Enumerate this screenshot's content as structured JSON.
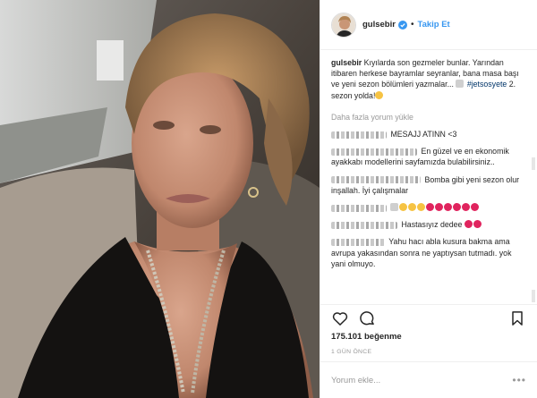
{
  "post": {
    "username": "gulsebir",
    "follow_label": "Takip Et",
    "separator": "•",
    "caption": {
      "username": "gulsebir",
      "text": "Kıyılarda son gezmeler bunlar. Yarından itibaren herkese bayramlar seyranlar, bana masa başı ve yeni sezon bölümleri yazmalar...",
      "hashtag": "#jetsosyete",
      "tail": "2. sezon yolda!"
    },
    "load_more": "Daha fazla yorum yükle",
    "comments": [
      {
        "text": "MESAJJ ATINN <3"
      },
      {
        "text": "En güzel ve en ekonomik ayakkabı modellerini sayfamızda bulabilirsiniz.."
      },
      {
        "text": "Bomba gibi yeni sezon olur inşallah. İyi çalışmalar"
      },
      {
        "text": ""
      },
      {
        "text": "Hastasıyız dedee"
      },
      {
        "text": "Yahu hacı abla kusura bakma ama avrupa yakasından sonra ne yaptıysan tutmadı. yok yani olmuyo."
      }
    ],
    "likes": "175.101 beğenme",
    "time": "1 GÜN ÖNCE",
    "comment_placeholder": "Yorum ekle...",
    "more_options": "•••"
  },
  "icons": {
    "like": "heart-icon",
    "comment": "comment-icon",
    "save": "bookmark-icon",
    "verified": "verified-badge-icon"
  },
  "colors": {
    "link": "#3897f0",
    "hashtag": "#003569",
    "muted": "#999999",
    "border": "#efefef"
  }
}
